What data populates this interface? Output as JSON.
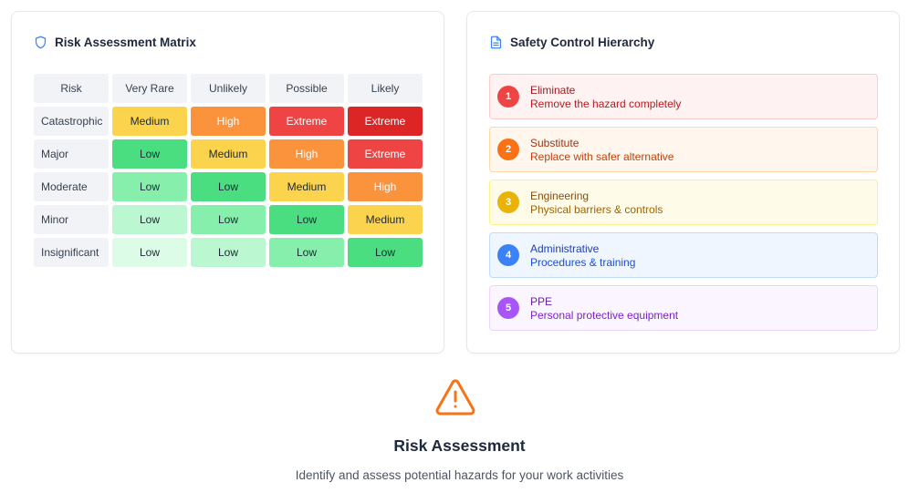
{
  "matrix_card": {
    "title": "Risk Assessment Matrix",
    "headers": [
      "Risk",
      "Very Rare",
      "Unlikely",
      "Possible",
      "Likely"
    ],
    "rows": [
      {
        "label": "Catastrophic",
        "cells": [
          "Medium",
          "High",
          "Extreme",
          "Extreme"
        ]
      },
      {
        "label": "Major",
        "cells": [
          "Low",
          "Medium",
          "High",
          "Extreme"
        ]
      },
      {
        "label": "Moderate",
        "cells": [
          "Low",
          "Low",
          "Medium",
          "High"
        ]
      },
      {
        "label": "Minor",
        "cells": [
          "Low",
          "Low",
          "Low",
          "Medium"
        ]
      },
      {
        "label": "Insignificant",
        "cells": [
          "Low",
          "Low",
          "Low",
          "Low"
        ]
      }
    ]
  },
  "hierarchy_card": {
    "title": "Safety Control Hierarchy",
    "items": [
      {
        "num": "1",
        "name": "Eliminate",
        "desc": "Remove the hazard completely"
      },
      {
        "num": "2",
        "name": "Substitute",
        "desc": "Replace with safer alternative"
      },
      {
        "num": "3",
        "name": "Engineering",
        "desc": "Physical barriers & controls"
      },
      {
        "num": "4",
        "name": "Administrative",
        "desc": "Procedures & training"
      },
      {
        "num": "5",
        "name": "PPE",
        "desc": "Personal protective equipment"
      }
    ]
  },
  "footer": {
    "title": "Risk Assessment",
    "subtitle": "Identify and assess potential hazards for your work activities"
  },
  "icons": {
    "matrix_card": "shield-icon",
    "hierarchy_card": "document-icon",
    "footer": "warning-triangle-icon"
  },
  "colors": {
    "matrix_cells": [
      [
        "#fcd34d",
        "#fb923c",
        "#ef4444",
        "#dc2626"
      ],
      [
        "#4ade80",
        "#fcd34d",
        "#fb923c",
        "#ef4444"
      ],
      [
        "#86efac",
        "#4ade80",
        "#fcd34d",
        "#fb923c"
      ],
      [
        "#bbf7d0",
        "#86efac",
        "#4ade80",
        "#fcd34d"
      ],
      [
        "#dcfce7",
        "#bbf7d0",
        "#86efac",
        "#4ade80"
      ]
    ],
    "hierarchy": [
      {
        "bg": "#fef2f2",
        "border": "#fecaca",
        "circle": "#ef4444",
        "name": "#991b1b",
        "desc": "#b91c1c"
      },
      {
        "bg": "#fff7ed",
        "border": "#fed7aa",
        "circle": "#f97316",
        "name": "#9a3412",
        "desc": "#c2410c"
      },
      {
        "bg": "#fefce8",
        "border": "#fef08a",
        "circle": "#eab308",
        "name": "#854d0e",
        "desc": "#a16207"
      },
      {
        "bg": "#eff6ff",
        "border": "#bfdbfe",
        "circle": "#3b82f6",
        "name": "#1e40af",
        "desc": "#1d4ed8"
      },
      {
        "bg": "#faf5ff",
        "border": "#e9d5ff",
        "circle": "#a855f7",
        "name": "#6b21a8",
        "desc": "#7e22ce"
      }
    ],
    "accent_blue": "#3b82f6",
    "warning_orange": "#f97316"
  }
}
